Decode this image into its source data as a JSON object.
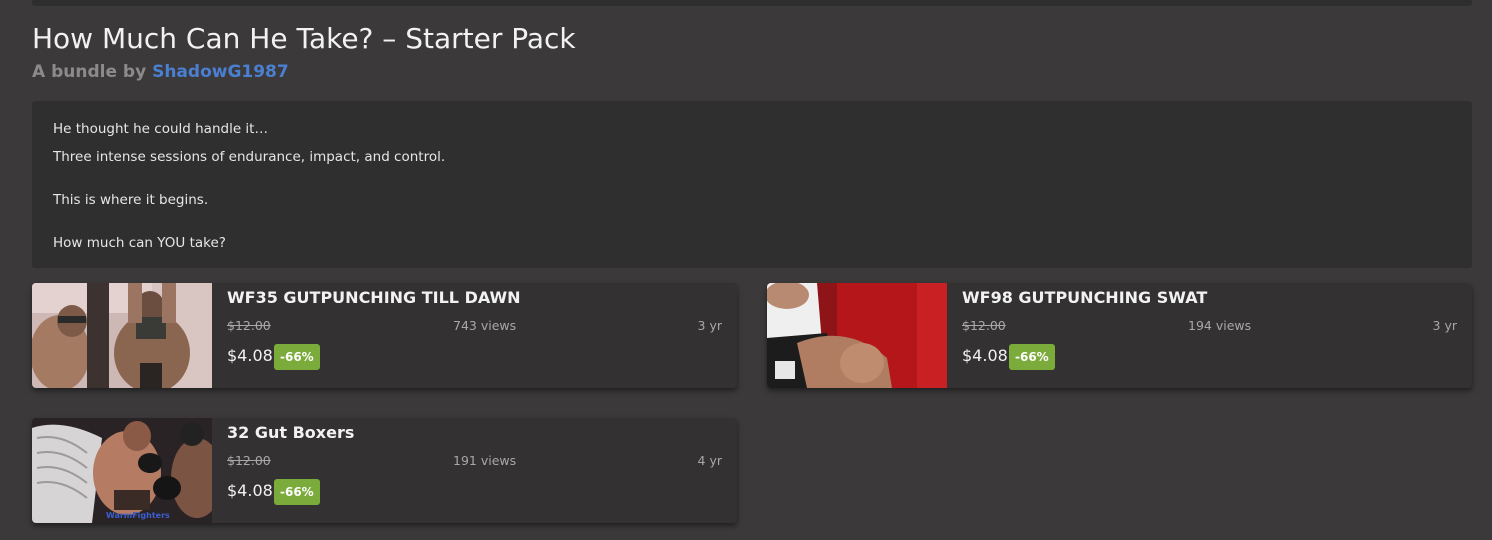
{
  "bundle": {
    "title": "How Much Can He Take? – Starter Pack",
    "byline_prefix": "A bundle by",
    "author": "ShadowG1987"
  },
  "description": {
    "line1": "He thought he could handle it…",
    "line2": "Three intense sessions of endurance, impact, and control.",
    "line3": "This is where it begins.",
    "line4": "How much can YOU take?"
  },
  "items": [
    {
      "title": "WF35 GUTPUNCHING TILL DAWN",
      "old_price": "$12.00",
      "views": "743 views",
      "age": "3 yr",
      "price": "$4.08",
      "discount": "-66%"
    },
    {
      "title": "WF98 GUTPUNCHING SWAT",
      "old_price": "$12.00",
      "views": "194 views",
      "age": "3 yr",
      "price": "$4.08",
      "discount": "-66%"
    },
    {
      "title": "32 Gut Boxers",
      "old_price": "$12.00",
      "views": "191 views",
      "age": "4 yr",
      "price": "$4.08",
      "discount": "-66%",
      "thumb_watermark": "WarmFighters"
    }
  ],
  "colors": {
    "background": "#3b393a",
    "panel": "#302f30",
    "link": "#4b7fd1",
    "badge": "#7bab3a"
  }
}
